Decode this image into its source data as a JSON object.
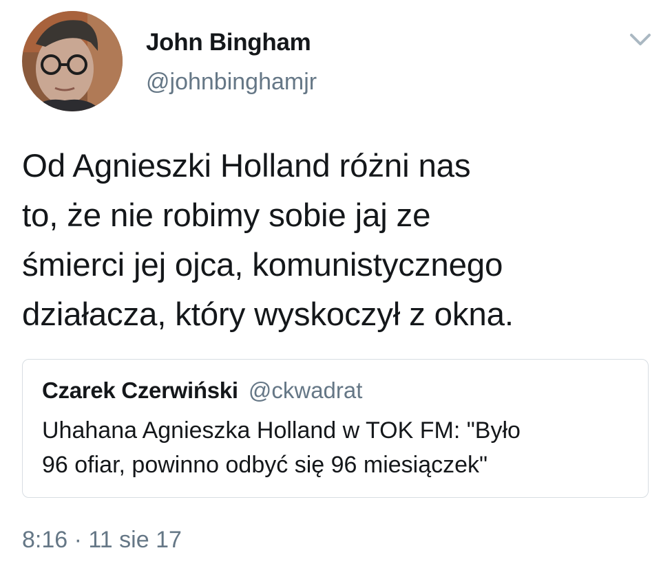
{
  "author": {
    "name": "John Bingham",
    "handle": "@johnbinghamjr",
    "avatar_icon": "profile-photo"
  },
  "menu_icon": "chevron-down-icon",
  "tweet": {
    "lines": [
      "Od Agnieszki Holland różni nas",
      "to, że nie robimy sobie jaj ze",
      "śmierci jej ojca, komunistycznego",
      "działacza, który wyskoczył z okna."
    ]
  },
  "quoted": {
    "name": "Czarek Czerwiński",
    "handle": "@ckwadrat",
    "lines": [
      "Uhahana Agnieszka Holland w TOK FM: \"Było",
      "96 ofiar, powinno odbyć się 96 miesiączek\""
    ]
  },
  "meta": {
    "time": "8:16",
    "separator": "·",
    "date": "11 sie 17"
  },
  "colors": {
    "text": "#14171a",
    "secondary": "#657786",
    "border": "#d7dde2",
    "icon": "#aab8c2"
  }
}
